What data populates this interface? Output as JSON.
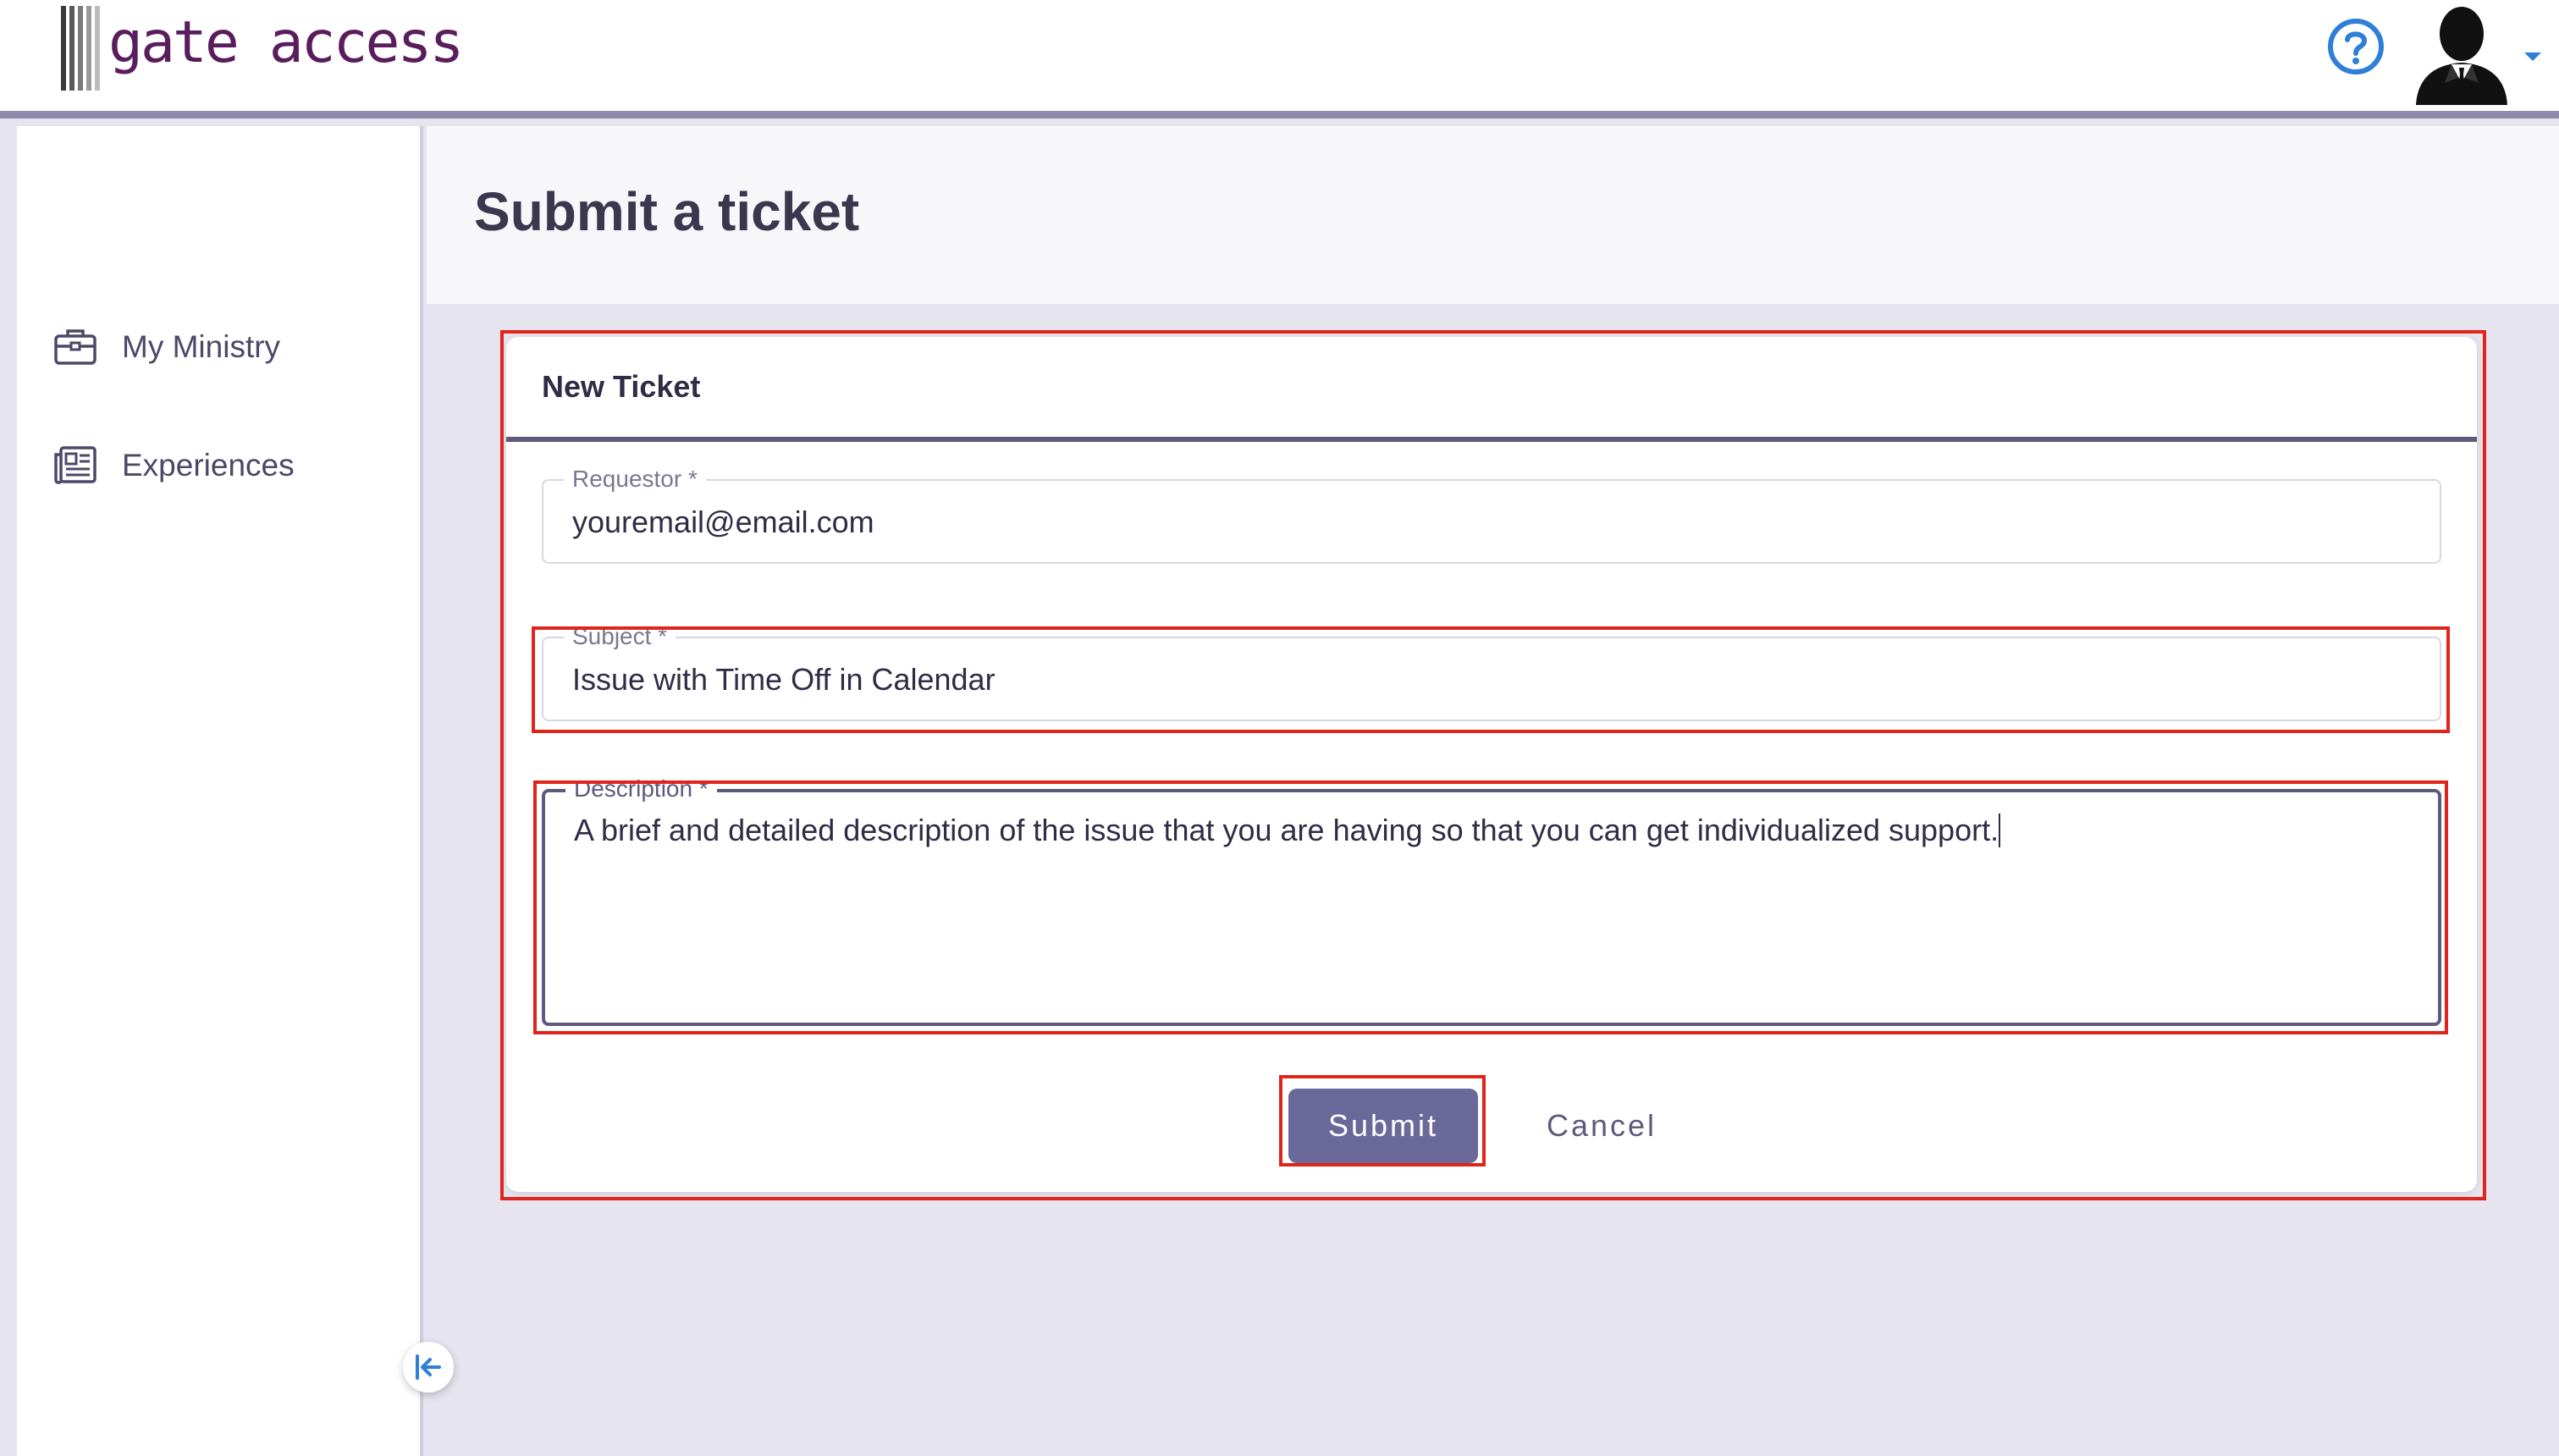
{
  "app": {
    "logo_text": "gate access",
    "help_icon": "help-circle-icon",
    "avatar_icon": "user-silhouette-icon",
    "accent_color": "#6b689a",
    "highlight_color": "#e0241b"
  },
  "sidebar": {
    "items": [
      {
        "label": "My Ministry",
        "icon": "briefcase-icon"
      },
      {
        "label": "Experiences",
        "icon": "newspaper-icon"
      }
    ],
    "collapse_icon": "collapse-left-icon"
  },
  "page": {
    "title": "Submit a ticket"
  },
  "form": {
    "card_title": "New Ticket",
    "requestor": {
      "label": "Requestor *",
      "value": "youremail@email.com"
    },
    "subject": {
      "label": "Subject *",
      "value": "Issue with Time Off in Calendar"
    },
    "description": {
      "label": "Description *",
      "value": "A brief and detailed description of the issue that you are having so that you can get individualized support."
    },
    "submit_label": "Submit",
    "cancel_label": "Cancel"
  }
}
